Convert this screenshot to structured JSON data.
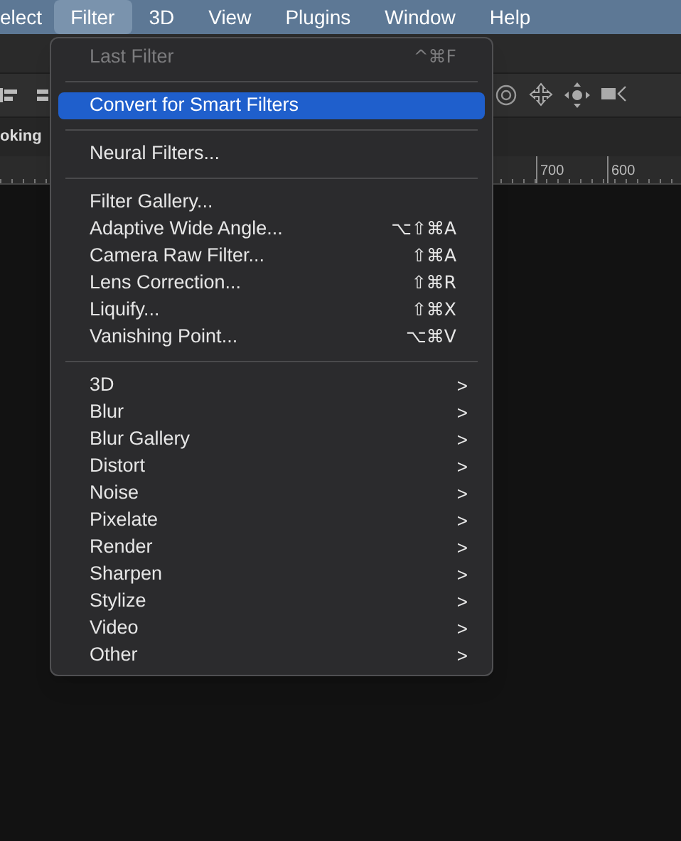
{
  "menu_bar": [
    {
      "label": "elect",
      "selected": false
    },
    {
      "label": "Filter",
      "selected": true
    },
    {
      "label": "3D",
      "selected": false
    },
    {
      "label": "View",
      "selected": false
    },
    {
      "label": "Plugins",
      "selected": false
    },
    {
      "label": "Window",
      "selected": false
    },
    {
      "label": "Help",
      "selected": false
    }
  ],
  "document_tab": {
    "label": "oking"
  },
  "ruler": {
    "labels": [
      "700",
      "600"
    ]
  },
  "filter_menu": [
    {
      "kind": "item",
      "label": "Last Filter",
      "shortcut": "^⌘F",
      "disabled": true,
      "selected": false
    },
    {
      "kind": "separator"
    },
    {
      "kind": "item",
      "label": "Convert for Smart Filters",
      "disabled": false,
      "selected": true
    },
    {
      "kind": "separator"
    },
    {
      "kind": "item",
      "label": "Neural Filters...",
      "disabled": false,
      "selected": false
    },
    {
      "kind": "separator"
    },
    {
      "kind": "item",
      "label": "Filter Gallery...",
      "disabled": false,
      "selected": false
    },
    {
      "kind": "item",
      "label": "Adaptive Wide Angle...",
      "shortcut": "⌥⇧⌘A",
      "disabled": false,
      "selected": false
    },
    {
      "kind": "item",
      "label": "Camera Raw Filter...",
      "shortcut": "⇧⌘A",
      "disabled": false,
      "selected": false
    },
    {
      "kind": "item",
      "label": "Lens Correction...",
      "shortcut": "⇧⌘R",
      "disabled": false,
      "selected": false
    },
    {
      "kind": "item",
      "label": "Liquify...",
      "shortcut": "⇧⌘X",
      "disabled": false,
      "selected": false
    },
    {
      "kind": "item",
      "label": "Vanishing Point...",
      "shortcut": "⌥⌘V",
      "disabled": false,
      "selected": false
    },
    {
      "kind": "separator"
    },
    {
      "kind": "submenu",
      "label": "3D",
      "arrow": ">"
    },
    {
      "kind": "submenu",
      "label": "Blur",
      "arrow": ">"
    },
    {
      "kind": "submenu",
      "label": "Blur Gallery",
      "arrow": ">"
    },
    {
      "kind": "submenu",
      "label": "Distort",
      "arrow": ">"
    },
    {
      "kind": "submenu",
      "label": "Noise",
      "arrow": ">"
    },
    {
      "kind": "submenu",
      "label": "Pixelate",
      "arrow": ">"
    },
    {
      "kind": "submenu",
      "label": "Render",
      "arrow": ">"
    },
    {
      "kind": "submenu",
      "label": "Sharpen",
      "arrow": ">"
    },
    {
      "kind": "submenu",
      "label": "Stylize",
      "arrow": ">"
    },
    {
      "kind": "submenu",
      "label": "Video",
      "arrow": ">"
    },
    {
      "kind": "submenu",
      "label": "Other",
      "arrow": ">"
    }
  ]
}
